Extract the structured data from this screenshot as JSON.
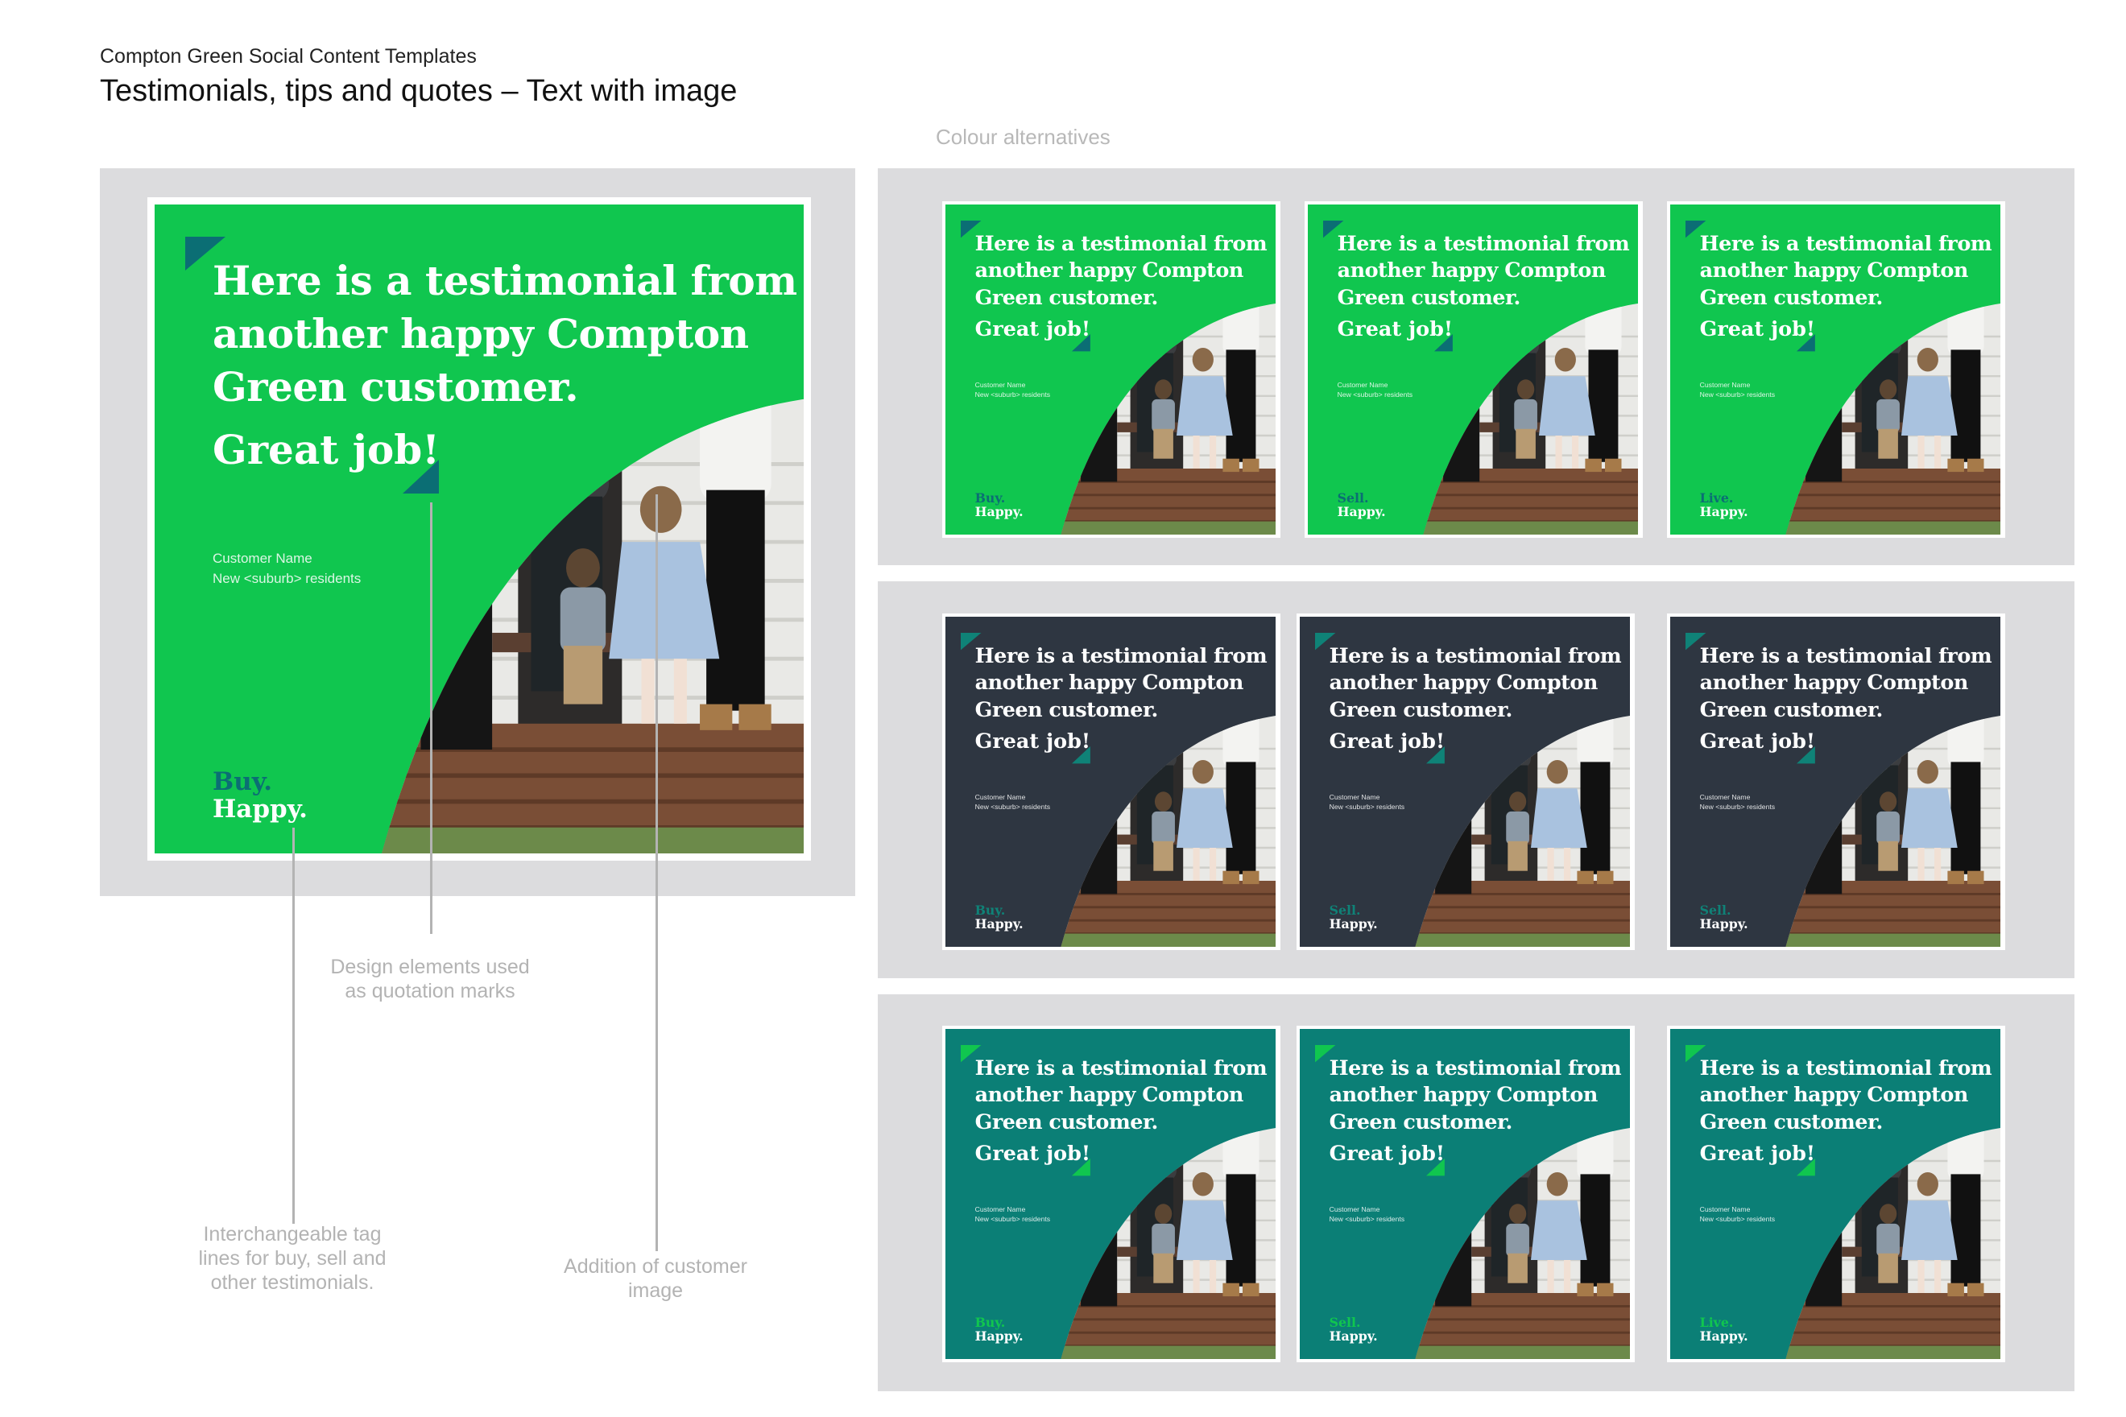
{
  "document": {
    "subtitle": "Compton Green Social Content Templates",
    "title": "Testimonials, tips and quotes – Text with image",
    "alternatives_label": "Colour alternatives"
  },
  "card": {
    "headline_lines": [
      "Here is a testimonial from",
      "another happy Compton",
      "Green customer."
    ],
    "great_job": "Great job!",
    "customer_name": "Customer Name",
    "customer_suburb": "New <suburb> residents",
    "happy": "Happy."
  },
  "main_card": {
    "tag": "Buy."
  },
  "variants": [
    {
      "tag": "Buy.",
      "theme": "green"
    },
    {
      "tag": "Sell.",
      "theme": "green"
    },
    {
      "tag": "Live.",
      "theme": "green"
    },
    {
      "tag": "Buy.",
      "theme": "navy"
    },
    {
      "tag": "Sell.",
      "theme": "navy"
    },
    {
      "tag": "Sell.",
      "theme": "navy"
    },
    {
      "tag": "Buy.",
      "theme": "teal"
    },
    {
      "tag": "Sell.",
      "theme": "teal"
    },
    {
      "tag": "Live.",
      "theme": "teal"
    }
  ],
  "themes": {
    "green": {
      "bg": "#10c64f",
      "mark": "#0b6e74",
      "tag": "#0b6e74"
    },
    "navy": {
      "bg": "#2e3641",
      "mark": "#0f8277",
      "tag": "#0f8277"
    },
    "teal": {
      "bg": "#0b7f76",
      "mark": "#10c64f",
      "tag": "#10c64f"
    }
  },
  "annotations": {
    "quotation": "Design elements used as quotation marks",
    "taglines": "Interchangeable tag lines for buy, sell and other testimonials.",
    "customer_image": "Addition of customer image"
  },
  "icons": [
    "quote-mark-top-icon",
    "quote-mark-bottom-icon",
    "customer-photo-illustration"
  ]
}
